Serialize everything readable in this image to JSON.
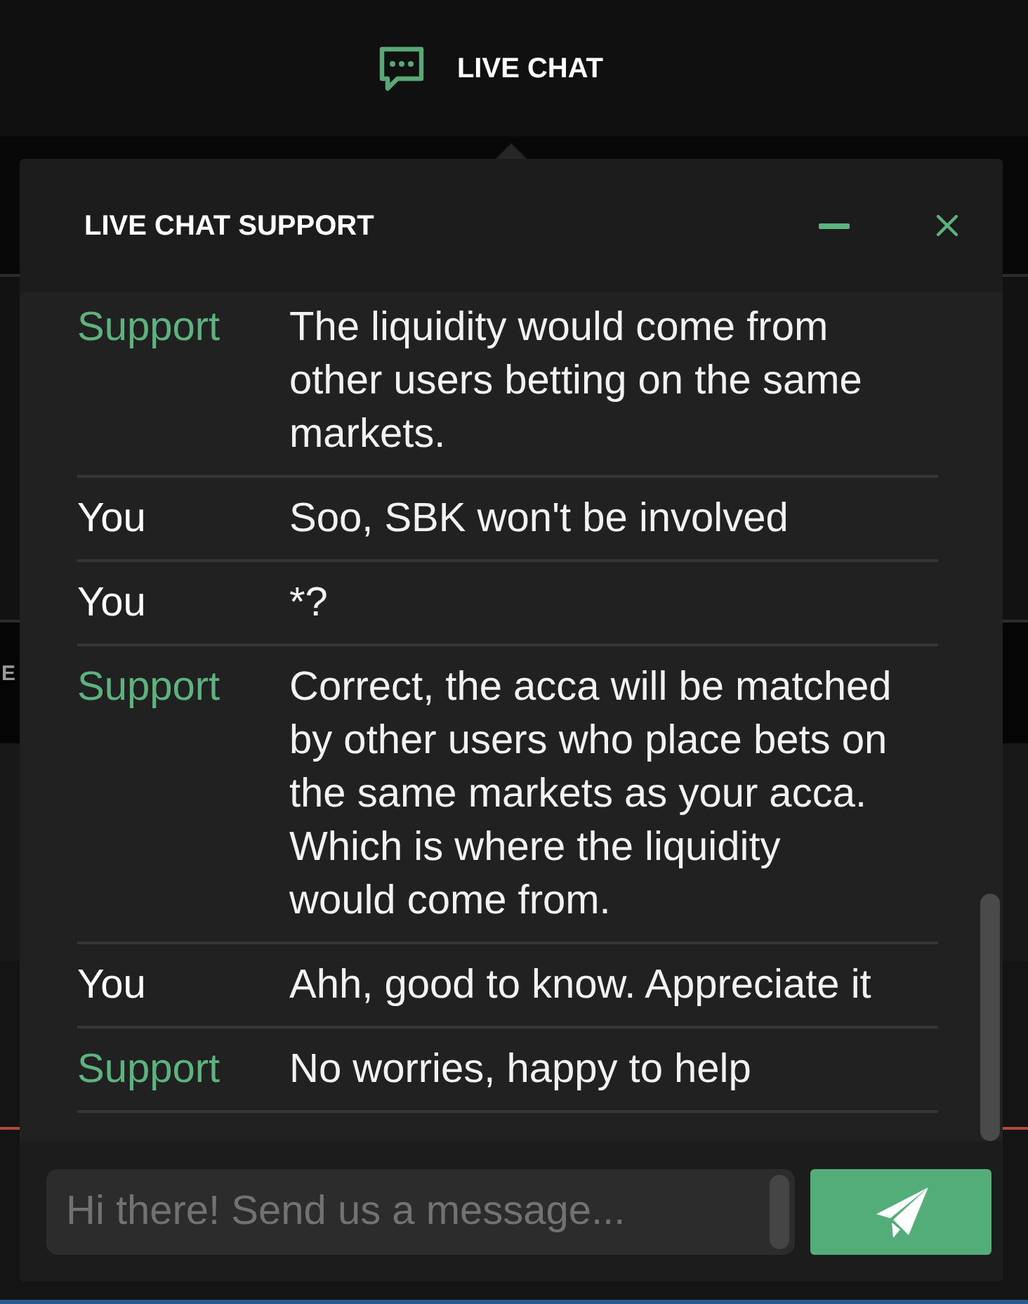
{
  "top_bar": {
    "title": "LIVE CHAT"
  },
  "background": {
    "fragment": "E"
  },
  "chat": {
    "title": "LIVE CHAT SUPPORT",
    "messages": [
      {
        "sender": "Support",
        "kind": "agent",
        "text": "The liquidity would come from other users betting on the same markets."
      },
      {
        "sender": "You",
        "kind": "user",
        "text": "Soo, SBK won't be involved"
      },
      {
        "sender": "You",
        "kind": "user",
        "text": "*?"
      },
      {
        "sender": "Support",
        "kind": "agent",
        "text": "Correct, the acca will be matched by other users who place bets on the same markets as your acca. Which is where the liquidity would come from."
      },
      {
        "sender": "You",
        "kind": "user",
        "text": "Ahh, good to know. Appreciate it"
      },
      {
        "sender": "Support",
        "kind": "agent",
        "text": "No worries, happy to help"
      }
    ],
    "input": {
      "placeholder": "Hi there! Send us a message..."
    }
  }
}
